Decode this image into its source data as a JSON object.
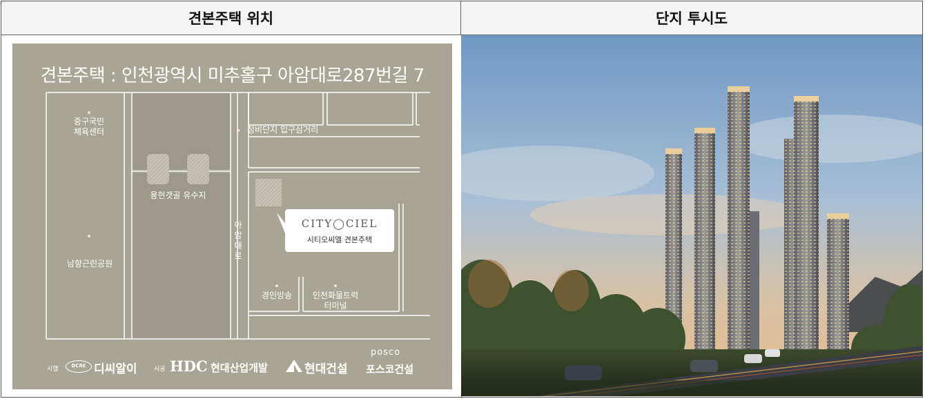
{
  "headers": {
    "left": "견본주택 위치",
    "right": "단지 투시도"
  },
  "map": {
    "title": "견본주택 : 인천광역시 미추홀구 아암대로287번길 7",
    "labels": {
      "sports_center_line1": "중구국민",
      "sports_center_line2": "체육센터",
      "junction": "정비단지 입구삼거리",
      "reservoir": "용현갯골 유수지",
      "park": "남항근린공원",
      "road_c1": "아",
      "road_c2": "암",
      "road_c3": "대",
      "road_c4": "로",
      "broadcast": "경인방송",
      "truck_line1": "인천화물트럭",
      "truck_line2": "터미널"
    },
    "callout": {
      "logo": "CITY◯CIEL",
      "subtitle": "시티오씨엘 견본주택"
    }
  },
  "credits": {
    "developer_role": "시행",
    "developer_badge": "DCRE",
    "developer_name": "디씨알이",
    "builder_role": "시공",
    "hdc_mark": "HDC",
    "hdc_name": "현대산업개발",
    "hyundai_name": "현대건설",
    "posco_mark": "posco",
    "posco_name": "포스코건설"
  },
  "colors": {
    "map_background": "#a8a594",
    "map_lines": "#ffffff",
    "sky_top": "#6f98c4",
    "sky_horizon": "#e6b98a"
  }
}
